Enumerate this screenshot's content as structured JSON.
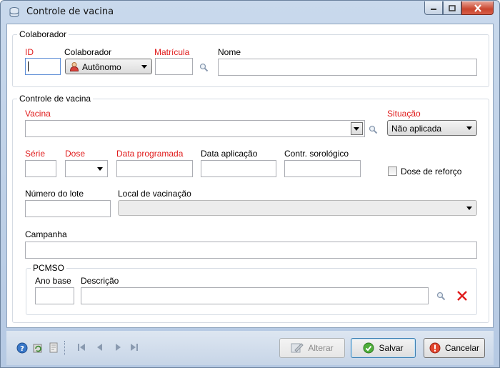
{
  "window": {
    "title": "Controle de vacina"
  },
  "colaborador_group": {
    "legend": "Colaborador",
    "id_label": "ID",
    "id_value": "",
    "colaborador_label": "Colaborador",
    "colaborador_value": "Autônomo",
    "matricula_label": "Matrícula",
    "matricula_value": "",
    "nome_label": "Nome",
    "nome_value": ""
  },
  "controle_group": {
    "legend": "Controle de vacina",
    "vacina_label": "Vacina",
    "vacina_value": "",
    "situacao_label": "Situação",
    "situacao_value": "Não aplicada",
    "serie_label": "Série",
    "dose_label": "Dose",
    "data_programada_label": "Data programada",
    "data_aplicacao_label": "Data aplicação",
    "contr_sorologico_label": "Contr. sorológico",
    "dose_reforco_label": "Dose de reforço",
    "dose_reforco_checked": false,
    "numero_lote_label": "Número do lote",
    "local_vacinacao_label": "Local de vacinação",
    "campanha_label": "Campanha"
  },
  "pcmso_group": {
    "legend": "PCMSO",
    "ano_base_label": "Ano base",
    "descricao_label": "Descrição"
  },
  "footer": {
    "alterar_label": "Alterar",
    "salvar_label": "Salvar",
    "cancelar_label": "Cancelar"
  },
  "colors": {
    "required_label": "#e01b1b",
    "accent": "#3c7fb1"
  },
  "icons": [
    "app-icon",
    "minimize-icon",
    "maximize-icon",
    "close-icon",
    "search-icon",
    "user-icon",
    "delete-icon",
    "help-icon",
    "refresh-icon",
    "export-icon",
    "first-record-icon",
    "previous-record-icon",
    "next-record-icon",
    "last-record-icon",
    "edit-icon",
    "save-icon",
    "cancel-icon"
  ]
}
